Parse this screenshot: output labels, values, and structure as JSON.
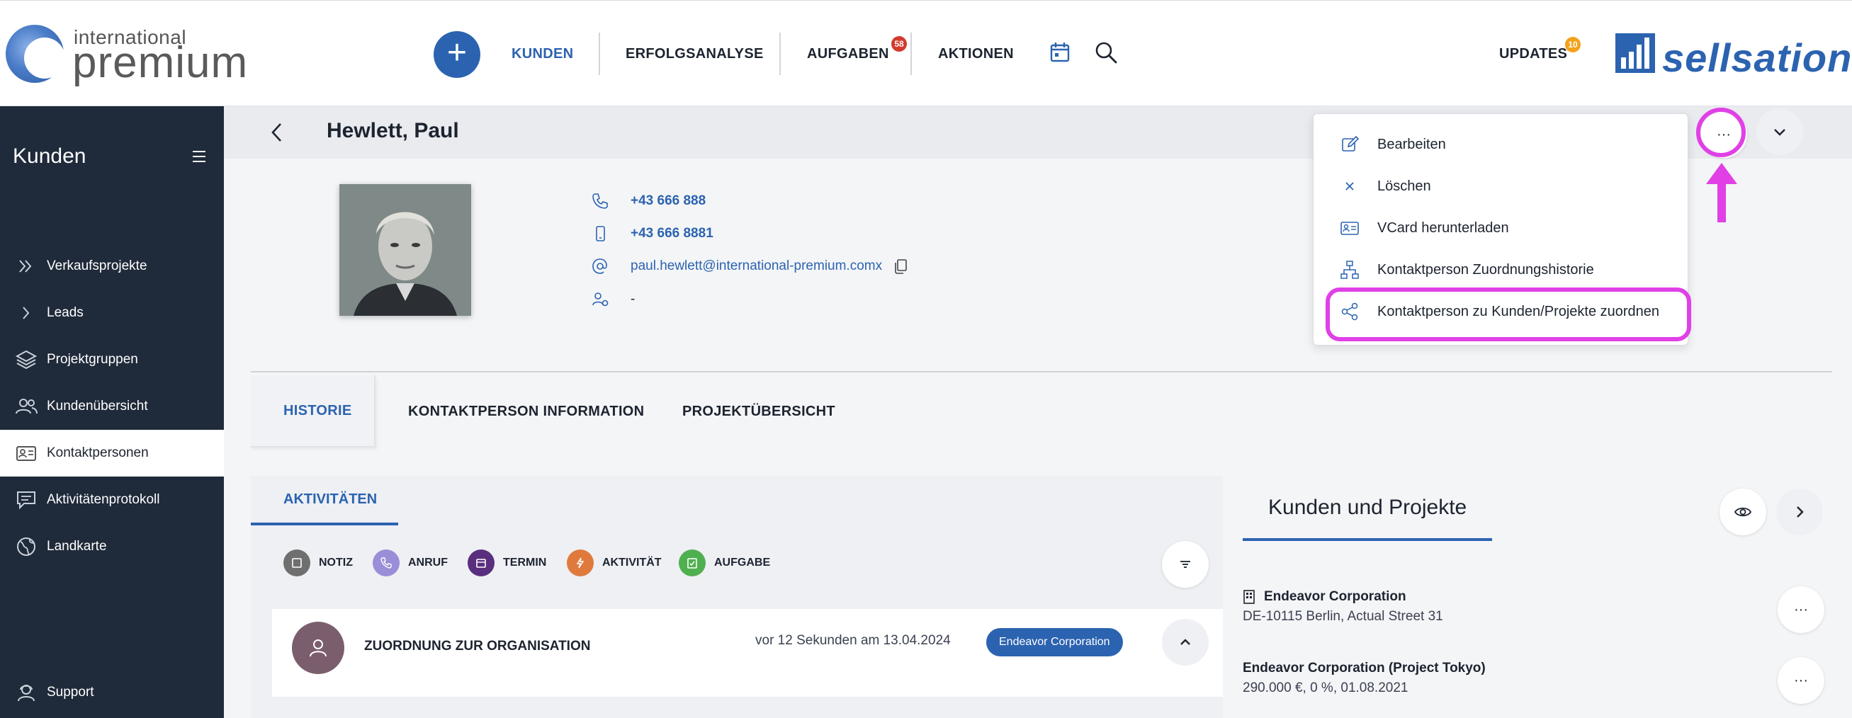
{
  "logo": {
    "small": "international",
    "big": "premium"
  },
  "brand": {
    "name": "sellsation"
  },
  "nav": {
    "add": "+",
    "kunden": "KUNDEN",
    "erfolgsanalyse": "ERFOLGSANALYSE",
    "aufgaben": "AUFGABEN",
    "aufgaben_count": "58",
    "aktionen": "AKTIONEN",
    "updates": "UPDATES",
    "updates_count": "10"
  },
  "sidebar": {
    "title": "Kunden",
    "items": [
      {
        "label": "Verkaufsprojekte",
        "icon": "double-chevron-icon"
      },
      {
        "label": "Leads",
        "icon": "chevron-right-icon"
      },
      {
        "label": "Projektgruppen",
        "icon": "layers-icon"
      },
      {
        "label": "Kundenübersicht",
        "icon": "users-icon"
      },
      {
        "label": "Kontaktpersonen",
        "icon": "id-card-icon"
      },
      {
        "label": "Aktivitätenprotokoll",
        "icon": "chat-icon"
      },
      {
        "label": "Landkarte",
        "icon": "globe-icon"
      }
    ],
    "support": "Support"
  },
  "person": {
    "name": "Hewlett, Paul",
    "phone": "+43 666 888",
    "mobile": "+43 666 8881",
    "email": "paul.hewlett@international-premium.comx",
    "assignee": "-"
  },
  "header": {
    "more": "···"
  },
  "tabs": {
    "historie": "HISTORIE",
    "info": "KONTAKTPERSON INFORMATION",
    "projects": "PROJEKTÜBERSICHT"
  },
  "activities": {
    "tab": "AKTIVITÄTEN",
    "filters": [
      {
        "label": "NOTIZ",
        "color": "#6f6f6f"
      },
      {
        "label": "ANRUF",
        "color": "#9a8ed8"
      },
      {
        "label": "TERMIN",
        "color": "#5a2e7e"
      },
      {
        "label": "AKTIVITÄT",
        "color": "#e07a3c"
      },
      {
        "label": "AUFGABE",
        "color": "#4fb04f"
      }
    ],
    "entry": {
      "title": "ZUORDNUNG ZUR ORGANISATION",
      "time": "vor 12 Sekunden am 13.04.2024",
      "badge": "Endeavor Corporation"
    }
  },
  "kunden_projekte": {
    "title": "Kunden und Projekte",
    "items": [
      {
        "name": "Endeavor Corporation",
        "detail": "DE-10115 Berlin, Actual Street 31",
        "more": "···"
      },
      {
        "name": "Endeavor Corporation (Project Tokyo)",
        "detail": "290.000 €, 0 %, 01.08.2021",
        "more": "···"
      }
    ]
  },
  "menu": {
    "items": [
      {
        "label": "Bearbeiten",
        "icon": "pencil-icon"
      },
      {
        "label": "Löschen",
        "icon": "x-icon"
      },
      {
        "label": "VCard herunterladen",
        "icon": "vcard-icon"
      },
      {
        "label": "Kontaktperson Zuordnungshistorie",
        "icon": "hierarchy-icon"
      },
      {
        "label": "Kontaktperson zu Kunden/Projekte zuordnen",
        "icon": "share-icon"
      }
    ]
  },
  "colors": {
    "accent": "#2c63b0",
    "sidebar": "#1f2a3a",
    "highlight": "#e040e6"
  }
}
